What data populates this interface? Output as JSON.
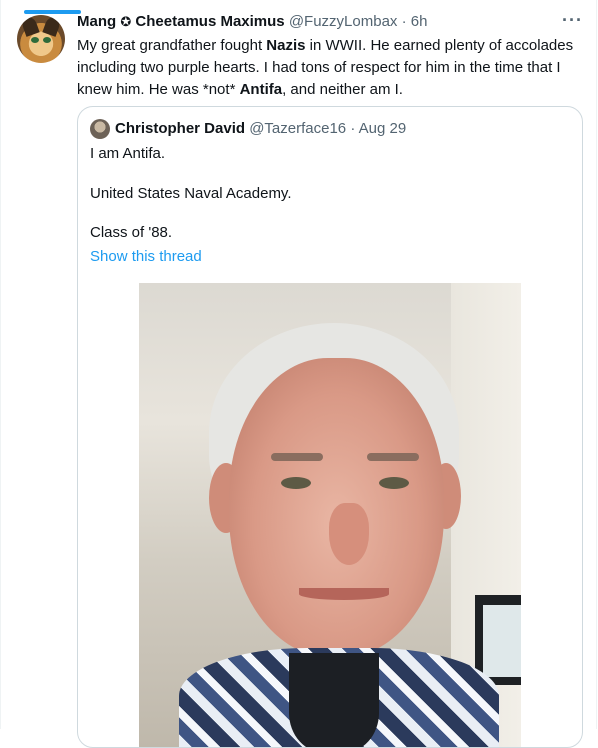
{
  "tweet": {
    "author_name": "Mang",
    "badge": "✪",
    "author_display": "Cheetamus Maximus",
    "handle": "@FuzzyLombax",
    "separator": "·",
    "time": "6h",
    "more": "···",
    "text_parts": {
      "p1": "My great grandfather fought ",
      "p2": "Nazis",
      "p3": " in WWII. He earned plenty of accolades including two purple hearts. I had tons of respect for him in the time that I knew him. He was *not* ",
      "p4": "Antifa",
      "p5": ", and neither am I."
    }
  },
  "quoted_tweet": {
    "author_name": "Christopher David",
    "handle": "@Tazerface16",
    "separator": "·",
    "date": "Aug 29",
    "lines": [
      "I am Antifa.",
      "United States Naval Academy.",
      "Class of '88."
    ],
    "show_thread": "Show this thread"
  },
  "colors": {
    "accent": "#1d9bf0",
    "text": "#0f1419",
    "secondary": "#536471",
    "border": "#cfd9de"
  },
  "icons": {
    "more": "more-horizontal-icon"
  }
}
